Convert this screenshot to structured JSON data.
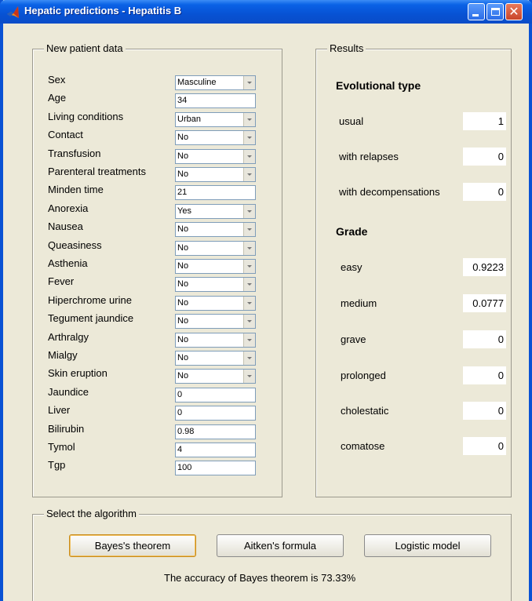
{
  "window": {
    "title": "Hepatic predictions - Hepatitis B"
  },
  "patient_panel": {
    "title": "New patient data",
    "fields": [
      {
        "label": "Sex",
        "value": "Masculine",
        "kind": "dropdown"
      },
      {
        "label": "Age",
        "value": "34",
        "kind": "text"
      },
      {
        "label": "Living conditions",
        "value": "Urban",
        "kind": "dropdown"
      },
      {
        "label": "Contact",
        "value": "No",
        "kind": "dropdown"
      },
      {
        "label": "Transfusion",
        "value": "No",
        "kind": "dropdown"
      },
      {
        "label": "Parenteral treatments",
        "value": "No",
        "kind": "dropdown"
      },
      {
        "label": "Minden time",
        "value": "21",
        "kind": "text"
      },
      {
        "label": "Anorexia",
        "value": "Yes",
        "kind": "dropdown"
      },
      {
        "label": "Nausea",
        "value": "No",
        "kind": "dropdown"
      },
      {
        "label": "Queasiness",
        "value": "No",
        "kind": "dropdown"
      },
      {
        "label": "Asthenia",
        "value": "No",
        "kind": "dropdown"
      },
      {
        "label": "Fever",
        "value": "No",
        "kind": "dropdown"
      },
      {
        "label": "Hiperchrome urine",
        "value": "No",
        "kind": "dropdown"
      },
      {
        "label": "Tegument jaundice",
        "value": "No",
        "kind": "dropdown"
      },
      {
        "label": "Arthralgy",
        "value": "No",
        "kind": "dropdown"
      },
      {
        "label": "Mialgy",
        "value": "No",
        "kind": "dropdown"
      },
      {
        "label": "Skin eruption",
        "value": "No",
        "kind": "dropdown"
      },
      {
        "label": "Jaundice",
        "value": "0",
        "kind": "text"
      },
      {
        "label": "Liver",
        "value": "0",
        "kind": "text"
      },
      {
        "label": "Bilirubin",
        "value": "0.98",
        "kind": "text"
      },
      {
        "label": "Tymol",
        "value": "4",
        "kind": "text"
      },
      {
        "label": "Tgp",
        "value": "100",
        "kind": "text"
      }
    ]
  },
  "results_panel": {
    "title": "Results",
    "evolutional_heading": "Evolutional type",
    "evolutional": [
      {
        "label": "usual",
        "value": "1"
      },
      {
        "label": "with relapses",
        "value": "0"
      },
      {
        "label": "with decompensations",
        "value": "0"
      }
    ],
    "grade_heading": "Grade",
    "grade": [
      {
        "label": "easy",
        "value": "0.9223"
      },
      {
        "label": "medium",
        "value": "0.0777"
      },
      {
        "label": "grave",
        "value": "0"
      },
      {
        "label": "prolonged",
        "value": "0"
      },
      {
        "label": "cholestatic",
        "value": "0"
      },
      {
        "label": "comatose",
        "value": "0"
      }
    ]
  },
  "algorithm_panel": {
    "title": "Select the algorithm",
    "buttons": [
      "Bayes's theorem",
      "Aitken's formula",
      "Logistic model"
    ],
    "status": "The accuracy of Bayes theorem is 73.33%"
  }
}
